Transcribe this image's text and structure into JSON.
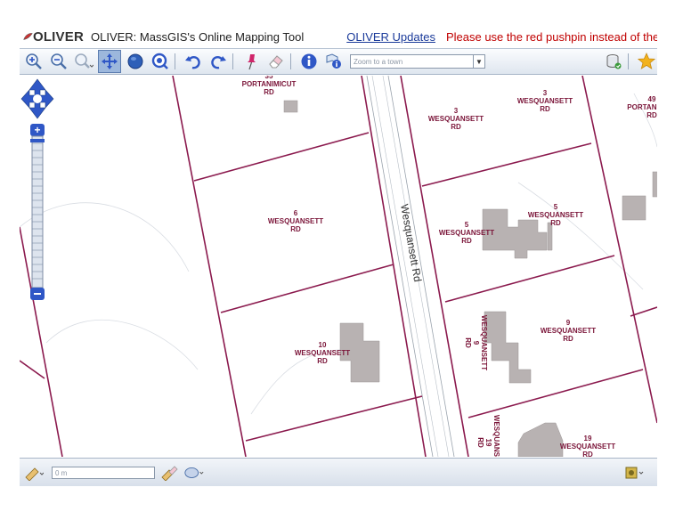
{
  "header": {
    "logo_text": "OLIVER",
    "title": "OLIVER: MassGIS's Online Mapping Tool",
    "updates_link": "OLIVER Updates",
    "notice": "Please use the red pushpin instead of the \"Se"
  },
  "toolbar": {
    "zoom_placeholder": "Zoom to a town",
    "tools": [
      "zoom-in-icon",
      "zoom-out-icon",
      "zoom-previous-icon",
      "pan-icon",
      "globe-icon",
      "full-extent-icon",
      "undo-icon",
      "redo-icon",
      "pushpin-icon",
      "eraser-icon",
      "info-icon",
      "identify-icon",
      "layers-icon",
      "star-icon"
    ]
  },
  "map": {
    "road_label": "Wesquansett Rd",
    "parcels": [
      {
        "num": "35",
        "street": "PORTANIMICUT",
        "suffix": "RD"
      },
      {
        "num": "3",
        "street": "WESQUANSETT",
        "suffix": "RD"
      },
      {
        "num": "3",
        "street": "WESQUANSETT",
        "suffix": "RD"
      },
      {
        "num": "49",
        "street": "PORTANI",
        "suffix": "RD"
      },
      {
        "num": "6",
        "street": "WESQUANSETT",
        "suffix": "RD"
      },
      {
        "num": "5",
        "street": "WESQUANSETT",
        "suffix": "RD"
      },
      {
        "num": "5",
        "street": "WESQUANSETT",
        "suffix": "RD"
      },
      {
        "num": "9",
        "street": "WESQUANSETT",
        "suffix": "RD"
      },
      {
        "num": "9",
        "street": "WESQUANSETT",
        "suffix": "RD"
      },
      {
        "num": "10",
        "street": "WESQUANSETT",
        "suffix": "RD"
      },
      {
        "num": "19",
        "street": "WESQUANSETT",
        "suffix": "RD"
      },
      {
        "num": "19",
        "street": "WESQUANSETT",
        "suffix": "RD"
      }
    ]
  },
  "bottom": {
    "measure_value": "0 m"
  },
  "colors": {
    "parcel_line": "#8b1a4e",
    "parcel_label": "#7a1438",
    "building": "#b8b2b2",
    "nav_blue": "#2f57c6"
  }
}
